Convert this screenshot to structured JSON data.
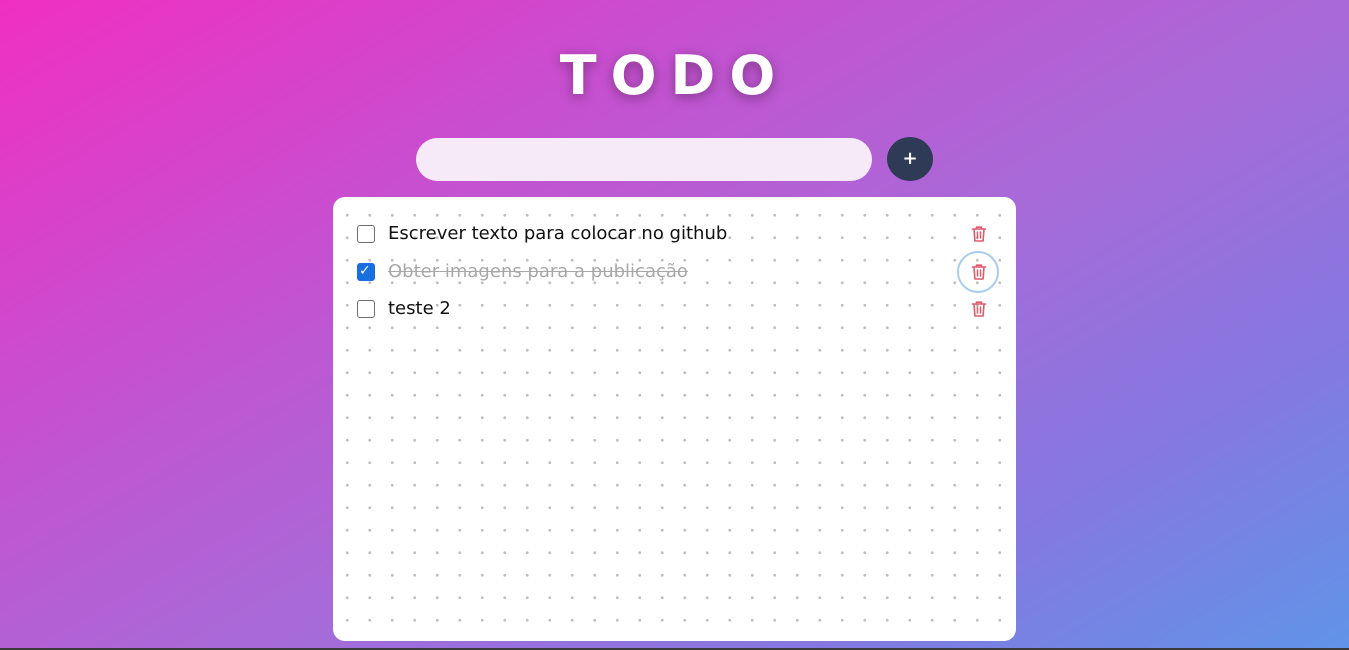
{
  "app": {
    "title": "TODO"
  },
  "new_task": {
    "value": "",
    "placeholder": "",
    "add_label": "+"
  },
  "tasks": [
    {
      "text": "Escrever texto para colocar no github",
      "done": false
    },
    {
      "text": "Obter imagens para a publicação",
      "done": true
    },
    {
      "text": "teste 2",
      "done": false
    }
  ],
  "colors": {
    "add_button": "#2f3b56",
    "delete_icon": "#e05a6a",
    "checkbox_checked": "#1a6fe0"
  },
  "icons": {
    "delete": "trash-icon",
    "check": "checkmark-icon"
  }
}
